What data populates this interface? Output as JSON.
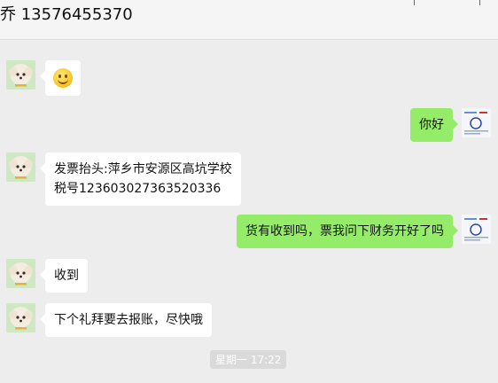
{
  "header": {
    "title": "乔 13576455370"
  },
  "messages": [
    {
      "side": "left",
      "type": "emoji",
      "icon": "smile-emoji"
    },
    {
      "side": "right",
      "type": "text",
      "text": "你好"
    },
    {
      "side": "left",
      "type": "text",
      "lines": [
        "发票抬头:萍乡市安源区高坑学校",
        "税号123603027363520336"
      ]
    },
    {
      "side": "right",
      "type": "text",
      "text": "货有收到吗，票我问下财务开好了吗"
    },
    {
      "side": "left",
      "type": "text",
      "text": "收到"
    },
    {
      "side": "left",
      "type": "text",
      "text": "下个礼拜要去报账，尽快哦"
    }
  ],
  "timestamp": "星期一 17:22",
  "colors": {
    "background": "#ededed",
    "bubble_self": "#95ec69",
    "bubble_other": "#ffffff"
  }
}
